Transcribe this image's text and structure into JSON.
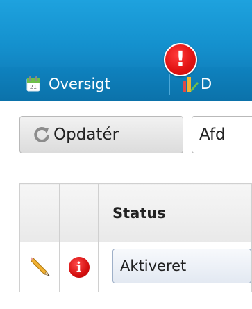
{
  "nav": {
    "items": [
      {
        "label": "Oversigt",
        "icon": "calendar-icon"
      },
      {
        "label": "D",
        "icon": "chart-icon"
      }
    ],
    "alert_badge": "!"
  },
  "toolbar": {
    "update_label": "Opdatér",
    "department_value": "Afd"
  },
  "table": {
    "headers": [
      "",
      "",
      "Status"
    ],
    "rows": [
      {
        "edit_icon": "pencil-icon",
        "info_icon": "info-icon",
        "info_glyph": "i",
        "status": "Aktiveret"
      }
    ]
  },
  "colors": {
    "header_blue": "#1490cd",
    "nav_blue": "#0b72aa",
    "alert_red": "#e21313"
  }
}
